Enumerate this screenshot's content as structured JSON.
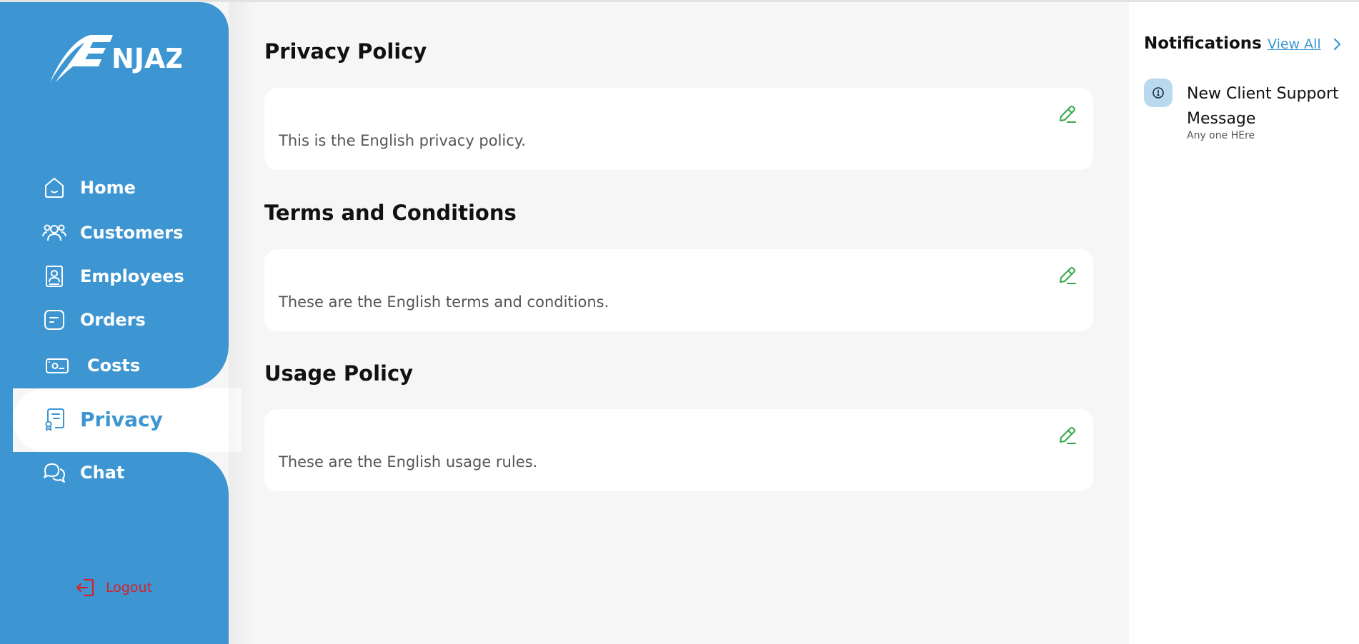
{
  "brand": {
    "logo_text": "NJAZ",
    "accent": "#3d96d2",
    "danger": "#d91f26",
    "edit_color": "#2fa84a"
  },
  "sidebar": {
    "items": [
      {
        "label": "Home",
        "icon": "home-icon"
      },
      {
        "label": "Customers",
        "icon": "customers-icon"
      },
      {
        "label": "Employees",
        "icon": "employee-badge-icon"
      },
      {
        "label": "Orders",
        "icon": "orders-icon"
      },
      {
        "label": "Costs",
        "icon": "costs-icon"
      },
      {
        "label": "Privacy",
        "icon": "privacy-certificate-icon",
        "active": true
      },
      {
        "label": "Chat",
        "icon": "chat-icon"
      }
    ],
    "logout_label": "Logout"
  },
  "main": {
    "sections": [
      {
        "title": "Privacy Policy",
        "text": "This is the English privacy policy."
      },
      {
        "title": "Terms and Conditions",
        "text": "These are the English terms and conditions."
      },
      {
        "title": "Usage Policy",
        "text": "These are the English usage rules."
      }
    ]
  },
  "notifications": {
    "title": "Notifications",
    "view_all_label": "View All",
    "items": [
      {
        "title": "New Client Support Message",
        "subtitle": "Any one HEre"
      }
    ]
  }
}
